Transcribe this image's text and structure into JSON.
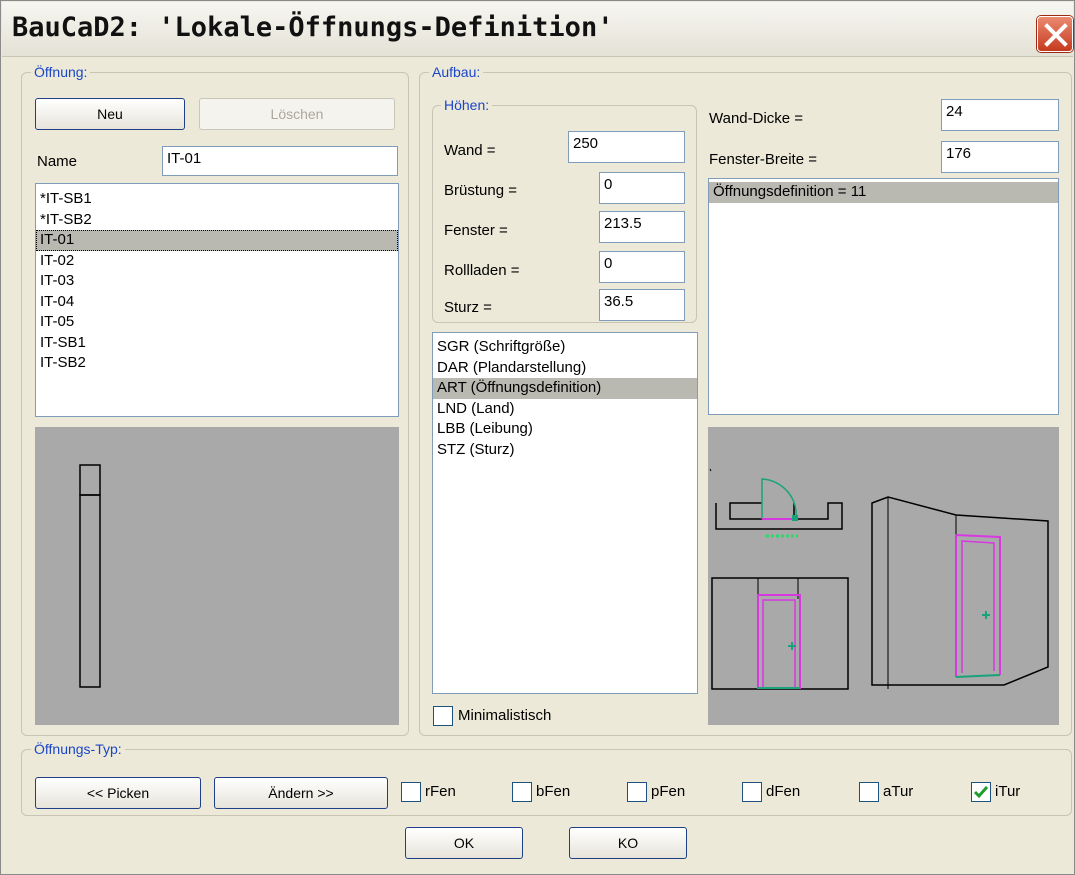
{
  "window": {
    "title": "BauCaD2: 'Lokale-Öffnungs-Definition'"
  },
  "oeffnung": {
    "legend": "Öffnung:",
    "new_label": "Neu",
    "delete_label": "Löschen",
    "name_label": "Name",
    "name_value": "IT-01",
    "items": [
      "*IT-SB1",
      "*IT-SB2",
      "IT-01",
      "IT-02",
      "IT-03",
      "IT-04",
      "IT-05",
      "IT-SB1",
      "IT-SB2"
    ],
    "selected": "IT-01"
  },
  "aufbau": {
    "legend": "Aufbau:",
    "hoehen": {
      "legend": "Höhen:",
      "fields": [
        {
          "label": "Wand =",
          "value": "250"
        },
        {
          "label": "Brüstung =",
          "value": "0"
        },
        {
          "label": "Fenster =",
          "value": "213.5"
        },
        {
          "label": "Rollladen =",
          "value": "0"
        },
        {
          "label": "Sturz =",
          "value": "36.5"
        }
      ]
    },
    "params": [
      "SGR (Schriftgröße)",
      "DAR (Plandarstellung)",
      "ART (Öffnungsdefinition)",
      "LND (Land)",
      "LBB (Leibung)",
      "STZ (Sturz)"
    ],
    "params_selected": "ART (Öffnungsdefinition)",
    "minimalistisch_label": "Minimalistisch",
    "wand_dicke_label": "Wand-Dicke =",
    "wand_dicke_value": "24",
    "fenster_breite_label": "Fenster-Breite =",
    "fenster_breite_value": "176",
    "definition_items": [
      "Öffnungsdefinition = 11"
    ]
  },
  "typ": {
    "legend": "Öffnungs-Typ:",
    "pick_label": "<< Picken",
    "change_label": "Ändern >>",
    "types": [
      {
        "label": "rFen",
        "checked": false
      },
      {
        "label": "bFen",
        "checked": false
      },
      {
        "label": "pFen",
        "checked": false
      },
      {
        "label": "dFen",
        "checked": false
      },
      {
        "label": "aTur",
        "checked": false
      },
      {
        "label": "iTur",
        "checked": true
      }
    ]
  },
  "footer": {
    "ok_label": "OK",
    "ko_label": "KO"
  },
  "colors": {
    "legend_text": "#1b46c8",
    "preview_bg": "#a9a9a9",
    "door_frame": "#d838e0",
    "door_swing": "#1aa37a",
    "check_mark": "#1e9c2c"
  },
  "icons": {
    "close": "close-icon",
    "check": "checkmark-icon"
  }
}
